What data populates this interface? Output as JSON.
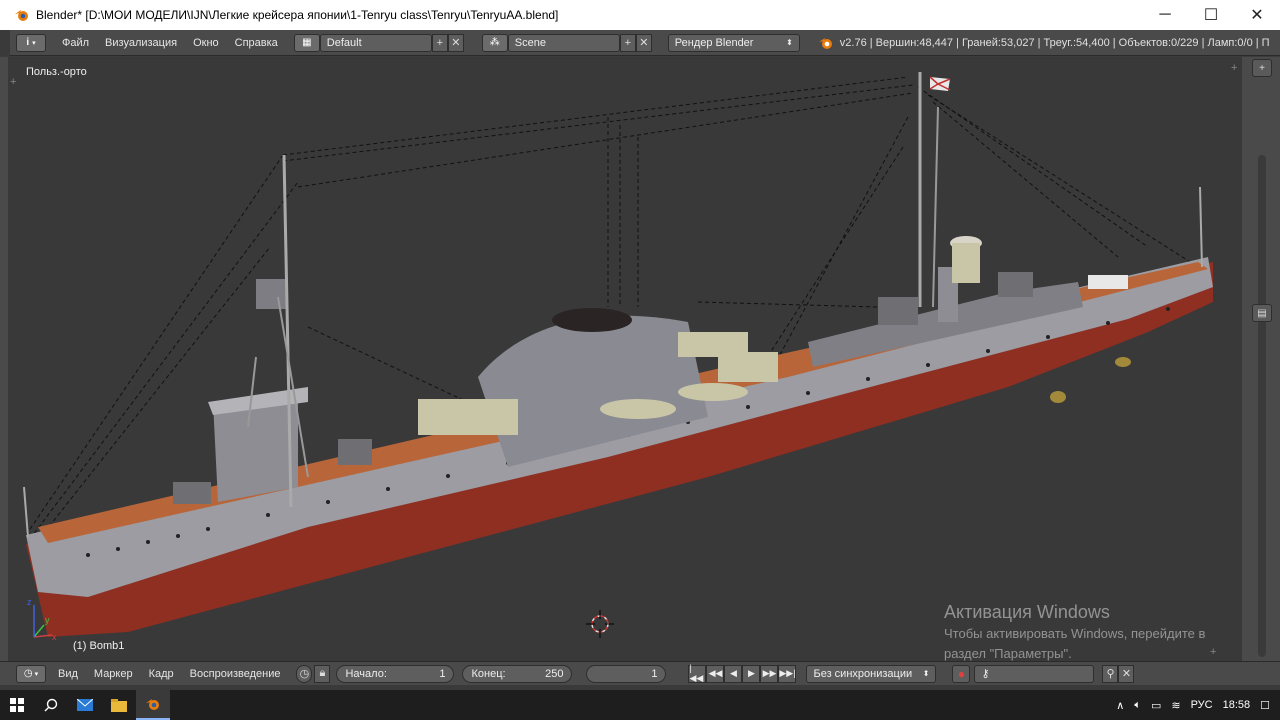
{
  "window": {
    "title": "Blender* [D:\\МОИ МОДЕЛИ\\IJN\\Легкие крейсера японии\\1-Tenryu class\\Tenryu\\TenryuAA.blend]",
    "minimize": "─",
    "maximize": "☐",
    "close": "✕"
  },
  "info_header": {
    "editor_icon": "i",
    "menus": [
      "Файл",
      "Визуализация",
      "Окно",
      "Справка"
    ],
    "screen_layout": "Default",
    "scene": "Scene",
    "render_engine": "Рендер Blender",
    "stats": "v2.76 | Вершин:48,447 | Граней:53,027 | Треуг.:54,400 | Объектов:0/229 | Ламп:0/0 | П"
  },
  "viewport": {
    "view_name": "Польз.-орто",
    "active_object": "(1) Bomb1",
    "axes": {
      "x": "x",
      "y": "y",
      "z": "z"
    }
  },
  "activation": {
    "title": "Активация Windows",
    "line1": "Чтобы активировать Windows, перейдите в",
    "line2": "раздел \"Параметры\"."
  },
  "timeline": {
    "menus": [
      "Вид",
      "Маркер",
      "Кадр",
      "Воспроизведение"
    ],
    "start_label": "Начало:",
    "start_value": "1",
    "end_label": "Конец:",
    "end_value": "250",
    "current_frame": "1",
    "sync": "Без синхронизации"
  },
  "taskbar": {
    "language": "РУС",
    "time": "18:58"
  },
  "colors": {
    "viewport_bg": "#393939",
    "hull_red": "#8e2f22",
    "hull_grey": "#9a9aa0",
    "deck": "#b8653a"
  }
}
